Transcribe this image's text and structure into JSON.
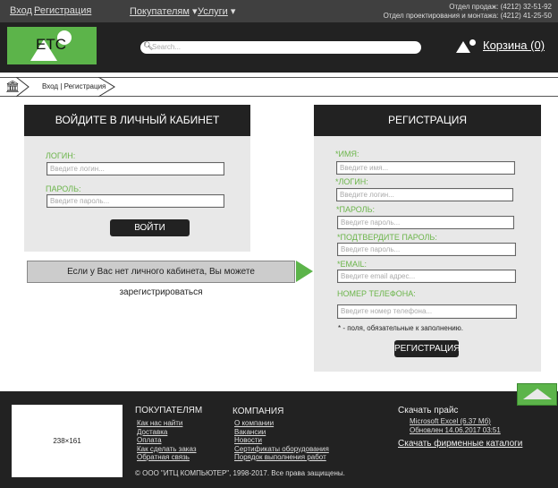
{
  "topbar": {
    "login": "Вход",
    "register": "Регистрация",
    "menu": [
      {
        "label": "Покупателям"
      },
      {
        "label": "Услуги"
      }
    ],
    "phone_sales": "Отдел продаж: (4212) 32-51-92",
    "phone_design": "Отдел проектирования и монтажа: (4212) 41-25-50"
  },
  "header": {
    "logo": "ETC",
    "search_placeholder": "Search...",
    "cart": "Корзина (0)"
  },
  "breadcrumb": {
    "current": "Вход | Регистрация"
  },
  "login": {
    "title": "ВОЙДИТЕ В ЛИЧНЫЙ КАБИНЕТ",
    "login_label": "ЛОГИН:",
    "login_ph": "Введите логин...",
    "pass_label": "ПАРОЛЬ:",
    "pass_ph": "Введите пароль...",
    "submit": "ВОЙТИ"
  },
  "hint": "Если у Вас нет личного кабинета, Вы можете зарегистрироваться",
  "register": {
    "title": "РЕГИСТРАЦИЯ",
    "fields": [
      {
        "label": "*ИМЯ:",
        "ph": "Введите имя..."
      },
      {
        "label": "*ЛОГИН:",
        "ph": "Введите логин..."
      },
      {
        "label": "*ПАРОЛЬ:",
        "ph": "Введите пароль..."
      },
      {
        "label": "*ПОДТВЕРДИТЕ ПАРОЛЬ:",
        "ph": "Введите пароль..."
      },
      {
        "label": "*EMAIL:",
        "ph": "Введите email адрес..."
      },
      {
        "label": "НОМЕР ТЕЛЕФОНА:",
        "ph": "Введите номер телефона..."
      }
    ],
    "note": "* - поля, обязательные к заполнению.",
    "submit": "РЕГИСТРАЦИЯ"
  },
  "footer": {
    "image_placeholder": "238×161",
    "buyers": {
      "title": "ПОКУПАТЕЛЯМ",
      "links": [
        "Как нас найти",
        "Доставка",
        "Оплата",
        "Как сделать заказ",
        "Обратная связь"
      ]
    },
    "company": {
      "title": "КОМПАНИЯ",
      "links": [
        "О компании",
        "Вакансии",
        "Новости",
        "Сертификаты оборудования",
        "Порядок выполнения работ"
      ]
    },
    "price": {
      "title": "Скачать прайс",
      "file": "Microsoft Excel (6.37 Мб)",
      "updated": "Обновлен 14.06.2017 03:51",
      "catalogs": "Скачать фирменные каталоги"
    },
    "copyright": "© ООО \"ИТЦ КОМПЬЮТЕР\", 1998-2017. Все права защищены."
  },
  "colors": {
    "accent": "#5cb44a",
    "dark": "#222222"
  }
}
